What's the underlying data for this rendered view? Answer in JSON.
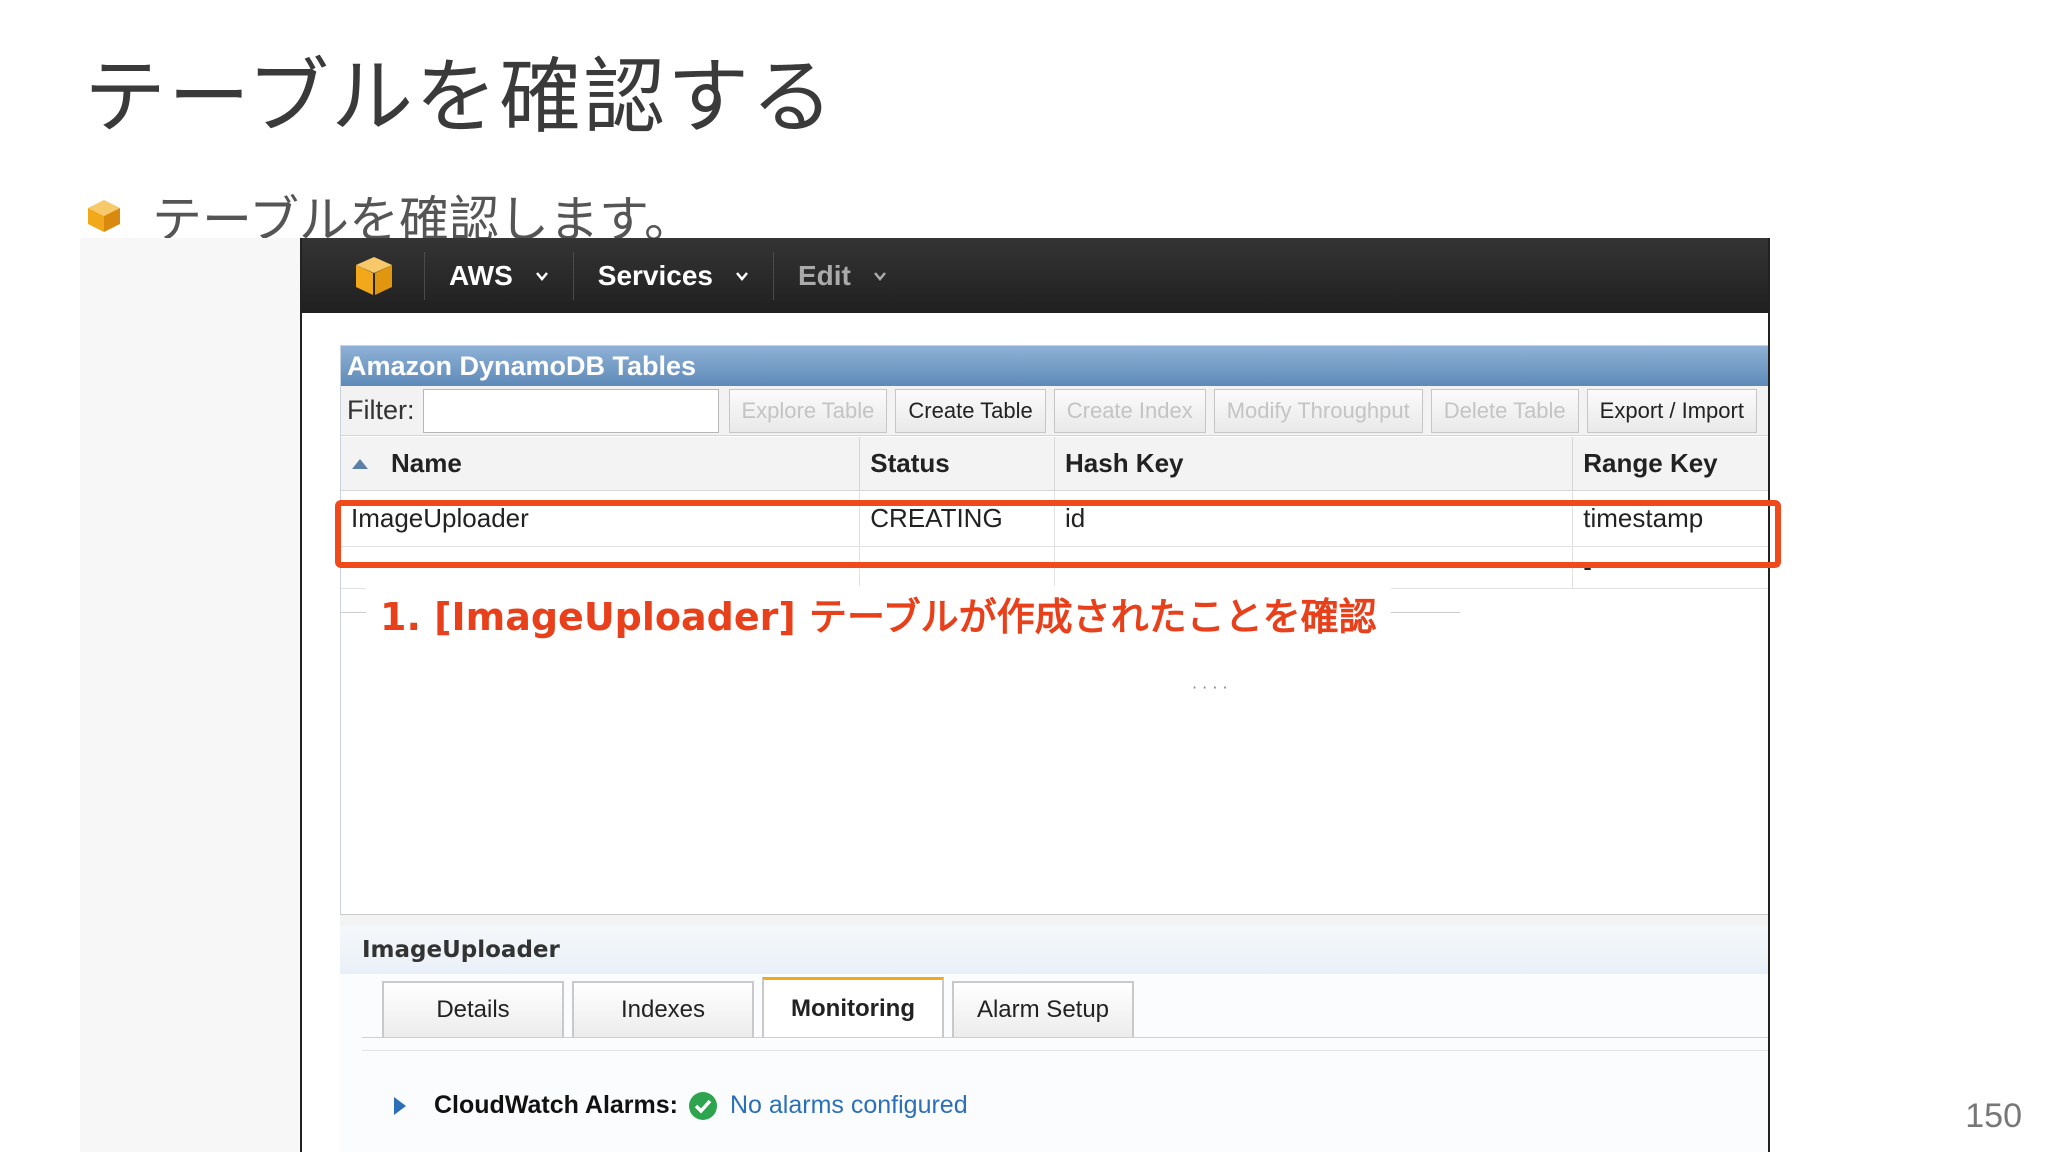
{
  "slide": {
    "title": "テーブルを確認する",
    "bullet_text": "テーブルを確認します。",
    "page_number": "150"
  },
  "navbar": {
    "items": [
      {
        "label": "AWS"
      },
      {
        "label": "Services"
      },
      {
        "label": "Edit"
      }
    ]
  },
  "panel": {
    "title": "Amazon DynamoDB Tables",
    "filter_label": "Filter:",
    "filter_value": "",
    "buttons": [
      {
        "label": "Explore Table",
        "enabled": false
      },
      {
        "label": "Create Table",
        "enabled": true
      },
      {
        "label": "Create Index",
        "enabled": false
      },
      {
        "label": "Modify Throughput",
        "enabled": false
      },
      {
        "label": "Delete Table",
        "enabled": false
      },
      {
        "label": "Export / Import",
        "enabled": true
      }
    ]
  },
  "table": {
    "columns": [
      "Name",
      "Status",
      "Hash Key",
      "Range Key"
    ],
    "rows": [
      {
        "name": "ImageUploader",
        "status": "CREATING",
        "hash_key": "id",
        "range_key": "timestamp"
      },
      {
        "name": "",
        "status": "",
        "hash_key": "",
        "range_key": "-"
      }
    ]
  },
  "annotation": {
    "text": "1. [ImageUploader] テーブルが作成されたことを確認",
    "color": "#e8401b"
  },
  "detail": {
    "title": "ImageUploader",
    "tabs": [
      "Details",
      "Indexes",
      "Monitoring",
      "Alarm Setup"
    ],
    "active_tab": "Monitoring",
    "cloudwatch_label": "CloudWatch Alarms:",
    "cloudwatch_status": "No alarms configured"
  },
  "colors": {
    "aws_orange": "#f1a81b",
    "highlight": "#f0491c",
    "link_blue": "#2b6fb8",
    "success_green": "#2ea44f"
  }
}
